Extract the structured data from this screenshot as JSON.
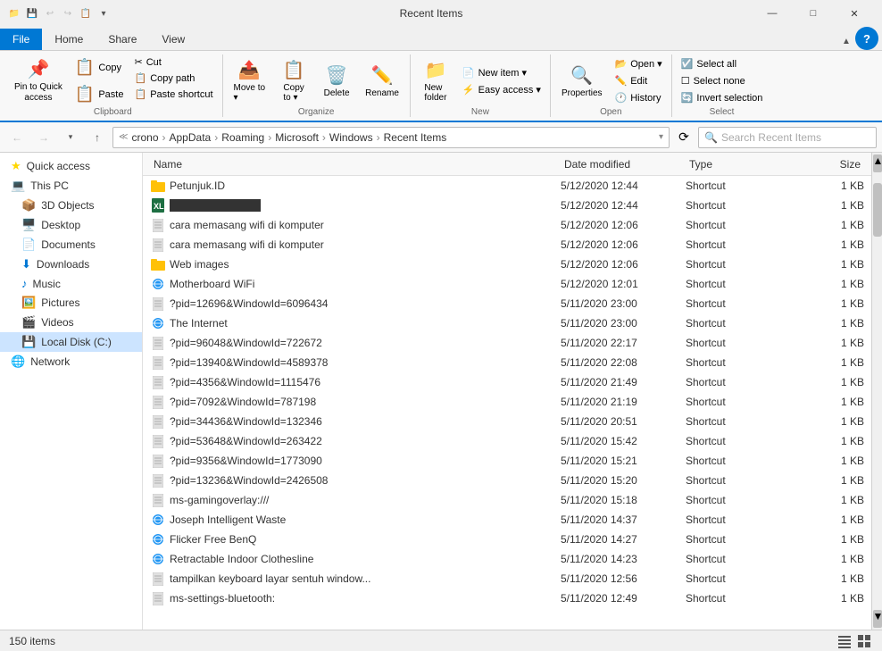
{
  "titlebar": {
    "title": "Recent Items",
    "minimize": "—",
    "maximize": "□",
    "close": "✕"
  },
  "ribbon": {
    "tabs": [
      "File",
      "Home",
      "Share",
      "View"
    ],
    "active_tab": "Home",
    "groups": {
      "clipboard": {
        "label": "Clipboard",
        "buttons": {
          "pin": "Pin to Quick\naccess",
          "copy": "Copy",
          "paste": "Paste",
          "cut": "Cut",
          "copy_path": "Copy path",
          "paste_shortcut": "Paste shortcut"
        }
      },
      "organize": {
        "label": "Organize",
        "buttons": {
          "move_to": "Move to",
          "copy_to": "Copy to",
          "delete": "Delete",
          "rename": "Rename"
        }
      },
      "new": {
        "label": "New",
        "buttons": {
          "new_folder": "New\nfolder",
          "new_item": "New item ▾",
          "easy_access": "Easy access ▾"
        }
      },
      "open": {
        "label": "Open",
        "buttons": {
          "properties": "Properties",
          "open": "Open ▾",
          "edit": "Edit",
          "history": "History"
        }
      },
      "select": {
        "label": "Select",
        "buttons": {
          "select_all": "Select all",
          "select_none": "Select none",
          "invert": "Invert selection"
        }
      }
    }
  },
  "addressbar": {
    "back": "←",
    "forward": "→",
    "up": "↑",
    "path": [
      "crono",
      "AppData",
      "Roaming",
      "Microsoft",
      "Windows",
      "Recent Items"
    ],
    "refresh": "⟳",
    "search_placeholder": "Search Recent Items"
  },
  "sidebar": {
    "items": [
      {
        "label": "Quick access",
        "icon": "⭐",
        "type": "header"
      },
      {
        "label": "This PC",
        "icon": "💻",
        "type": "item"
      },
      {
        "label": "3D Objects",
        "icon": "📦",
        "type": "item",
        "indent": true
      },
      {
        "label": "Desktop",
        "icon": "🖥️",
        "type": "item",
        "indent": true
      },
      {
        "label": "Documents",
        "icon": "📄",
        "type": "item",
        "indent": true
      },
      {
        "label": "Downloads",
        "icon": "⬇️",
        "type": "item",
        "indent": true
      },
      {
        "label": "Music",
        "icon": "🎵",
        "type": "item",
        "indent": true
      },
      {
        "label": "Pictures",
        "icon": "🖼️",
        "type": "item",
        "indent": true
      },
      {
        "label": "Videos",
        "icon": "🎬",
        "type": "item",
        "indent": true
      },
      {
        "label": "Local Disk (C:)",
        "icon": "💾",
        "type": "item",
        "indent": true,
        "selected": true
      },
      {
        "label": "Network",
        "icon": "🌐",
        "type": "item"
      }
    ]
  },
  "columns": {
    "name": "Name",
    "date_modified": "Date modified",
    "type": "Type",
    "size": "Size"
  },
  "files": [
    {
      "name": "Petunjuk.ID",
      "date": "5/12/2020 12:44",
      "type": "Shortcut",
      "size": "1 KB",
      "icon": "📁",
      "icon_color": "#FFC107"
    },
    {
      "name": "████████████",
      "date": "5/12/2020 12:44",
      "type": "Shortcut",
      "size": "1 KB",
      "icon": "📊",
      "icon_color": "#1D6F42"
    },
    {
      "name": "cara memasang wifi di komputer",
      "date": "5/12/2020 12:06",
      "type": "Shortcut",
      "size": "1 KB",
      "icon": "📄",
      "icon_color": "#aaa"
    },
    {
      "name": "cara memasang wifi di komputer",
      "date": "5/12/2020 12:06",
      "type": "Shortcut",
      "size": "1 KB",
      "icon": "📄",
      "icon_color": "#aaa"
    },
    {
      "name": "Web images",
      "date": "5/12/2020 12:06",
      "type": "Shortcut",
      "size": "1 KB",
      "icon": "📁",
      "icon_color": "#FFC107"
    },
    {
      "name": "Motherboard WiFi",
      "date": "5/12/2020 12:01",
      "type": "Shortcut",
      "size": "1 KB",
      "icon": "🌐",
      "icon_color": "#2196F3"
    },
    {
      "name": "?pid=12696&WindowId=6096434",
      "date": "5/11/2020 23:00",
      "type": "Shortcut",
      "size": "1 KB",
      "icon": "📄",
      "icon_color": "#aaa"
    },
    {
      "name": "The Internet",
      "date": "5/11/2020 23:00",
      "type": "Shortcut",
      "size": "1 KB",
      "icon": "🌐",
      "icon_color": "#2196F3"
    },
    {
      "name": "?pid=96048&WindowId=722672",
      "date": "5/11/2020 22:17",
      "type": "Shortcut",
      "size": "1 KB",
      "icon": "📄",
      "icon_color": "#aaa"
    },
    {
      "name": "?pid=13940&WindowId=4589378",
      "date": "5/11/2020 22:08",
      "type": "Shortcut",
      "size": "1 KB",
      "icon": "📄",
      "icon_color": "#aaa"
    },
    {
      "name": "?pid=4356&WindowId=1115476",
      "date": "5/11/2020 21:49",
      "type": "Shortcut",
      "size": "1 KB",
      "icon": "📄",
      "icon_color": "#aaa"
    },
    {
      "name": "?pid=7092&WindowId=787198",
      "date": "5/11/2020 21:19",
      "type": "Shortcut",
      "size": "1 KB",
      "icon": "📄",
      "icon_color": "#aaa"
    },
    {
      "name": "?pid=34436&WindowId=132346",
      "date": "5/11/2020 20:51",
      "type": "Shortcut",
      "size": "1 KB",
      "icon": "📄",
      "icon_color": "#aaa"
    },
    {
      "name": "?pid=53648&WindowId=263422",
      "date": "5/11/2020 15:42",
      "type": "Shortcut",
      "size": "1 KB",
      "icon": "📄",
      "icon_color": "#aaa"
    },
    {
      "name": "?pid=9356&WindowId=1773090",
      "date": "5/11/2020 15:21",
      "type": "Shortcut",
      "size": "1 KB",
      "icon": "📄",
      "icon_color": "#aaa"
    },
    {
      "name": "?pid=13236&WindowId=2426508",
      "date": "5/11/2020 15:20",
      "type": "Shortcut",
      "size": "1 KB",
      "icon": "📄",
      "icon_color": "#aaa"
    },
    {
      "name": "ms-gamingoverlay:///",
      "date": "5/11/2020 15:18",
      "type": "Shortcut",
      "size": "1 KB",
      "icon": "📄",
      "icon_color": "#aaa"
    },
    {
      "name": "Joseph Intelligent Waste",
      "date": "5/11/2020 14:37",
      "type": "Shortcut",
      "size": "1 KB",
      "icon": "🌐",
      "icon_color": "#2196F3"
    },
    {
      "name": "Flicker Free BenQ",
      "date": "5/11/2020 14:27",
      "type": "Shortcut",
      "size": "1 KB",
      "icon": "🌐",
      "icon_color": "#2196F3"
    },
    {
      "name": "Retractable Indoor Clothesline",
      "date": "5/11/2020 14:23",
      "type": "Shortcut",
      "size": "1 KB",
      "icon": "🌐",
      "icon_color": "#2196F3"
    },
    {
      "name": "tampilkan keyboard layar sentuh window...",
      "date": "5/11/2020 12:56",
      "type": "Shortcut",
      "size": "1 KB",
      "icon": "📄",
      "icon_color": "#aaa"
    },
    {
      "name": "ms-settings-bluetooth:",
      "date": "5/11/2020 12:49",
      "type": "Shortcut",
      "size": "1 KB",
      "icon": "📄",
      "icon_color": "#aaa"
    }
  ],
  "statusbar": {
    "count": "150 items",
    "view_list": "☰",
    "view_grid": "⊞"
  }
}
